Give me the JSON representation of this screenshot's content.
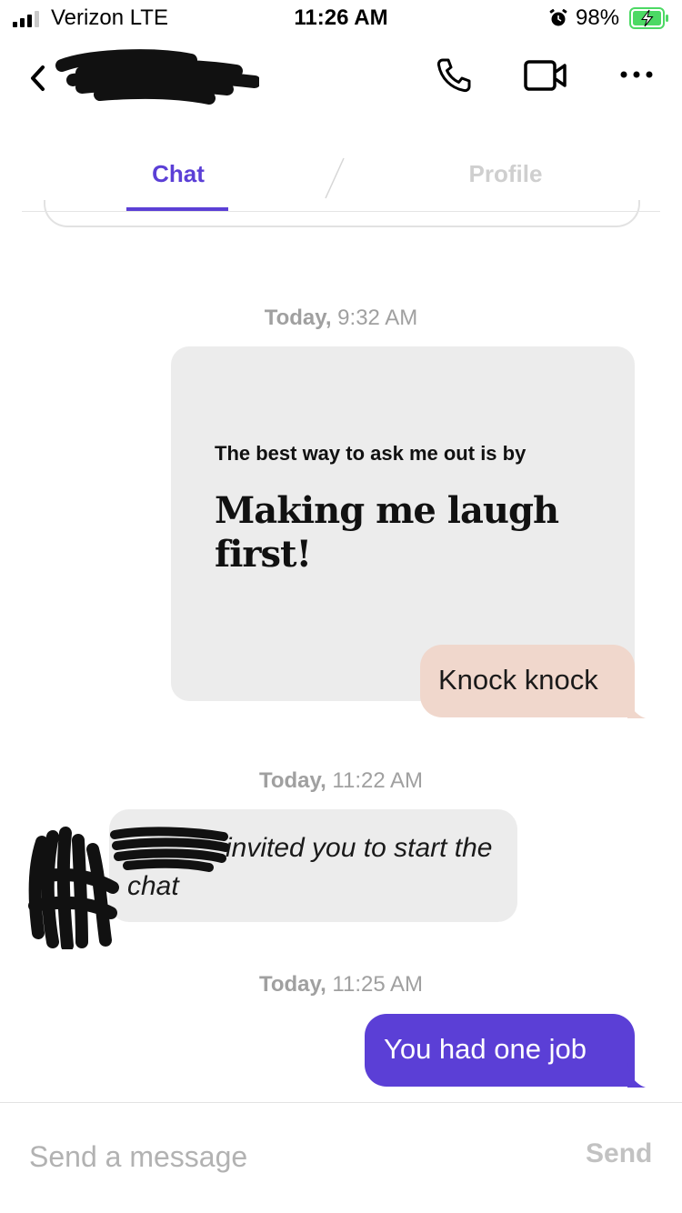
{
  "status_bar": {
    "carrier": "Verizon  LTE",
    "time": "11:26 AM",
    "battery_percent": "98%",
    "battery_level": 0.98
  },
  "header": {
    "contact_name_redacted": true,
    "icons": [
      "back-chevron-icon",
      "phone-icon",
      "video-camera-icon",
      "more-dots-icon"
    ]
  },
  "tabs": [
    {
      "label": "Chat",
      "active": true
    },
    {
      "label": "Profile",
      "active": false
    }
  ],
  "conversation": {
    "groups": [
      {
        "timestamp_day": "Today,",
        "timestamp_time": " 9:32 AM",
        "prompt_question": "The best way to ask me out is by",
        "prompt_answer": "Making me laugh first!",
        "reply": "Knock knock"
      },
      {
        "timestamp_day": "Today,",
        "timestamp_time": " 11:22 AM",
        "system_message": "invited you to start the chat"
      },
      {
        "timestamp_day": "Today,",
        "timestamp_time": " 11:25 AM",
        "message": "You had one job"
      }
    ]
  },
  "composer": {
    "placeholder": "Send a message",
    "send_label": "Send"
  },
  "colors": {
    "accent": "#5b3fd6",
    "reply_bubble": "#f0d7cc",
    "card_gray": "#ececec",
    "timestamp_gray": "#a0a0a0"
  }
}
